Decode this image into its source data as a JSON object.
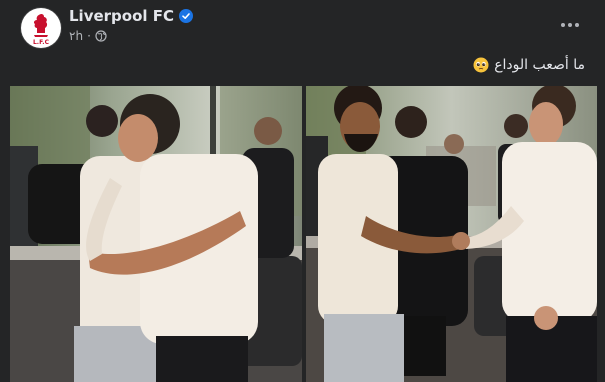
{
  "post": {
    "page_name": "Liverpool FC",
    "timestamp": "٢h",
    "caption": "ما أصعب الوداع",
    "more_options": "More options",
    "photos": [
      {
        "alt": "Photo 1"
      },
      {
        "alt": "Photo 2"
      }
    ]
  },
  "icons": {
    "avatar": "liverbird-logo-icon",
    "verified": "verified-badge-icon",
    "audience": "globe-icon",
    "more": "more-horizontal-icon",
    "emoji": "pleading-face-emoji-icon"
  },
  "colors": {
    "background": "#242526",
    "text_primary": "#e4e6eb",
    "text_secondary": "#b0b3b8",
    "verified_blue": "#1b74e4",
    "lfc_red": "#c8102e"
  }
}
